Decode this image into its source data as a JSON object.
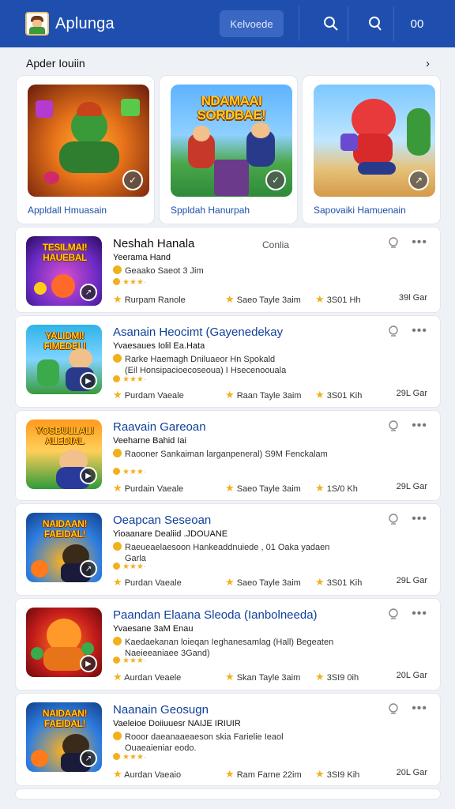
{
  "header": {
    "title": "Aplunga",
    "search_chip": "Kelvoede",
    "icons": [
      "search-icon",
      "search-alt-icon",
      "menu-icon"
    ],
    "right_text": "00"
  },
  "featured": {
    "heading": "Apder Iouiin",
    "cards": [
      {
        "label": "Appldall Hmuasain",
        "title": "",
        "colors": [
          "#e8741a",
          "#6a1c0c"
        ]
      },
      {
        "label": "Sppldah Hanurpah",
        "title": "NDAMAAI SORDBAE!",
        "colors": [
          "#5db3ff",
          "#2e8a3a"
        ]
      },
      {
        "label": "Sapovaiki Hamuenain",
        "title": "",
        "colors": [
          "#7cc8ff",
          "#e6c27a"
        ]
      }
    ]
  },
  "rows": [
    {
      "name": "Neshah Hanala",
      "name_dark": true,
      "contact": "Conlia",
      "subtitle": "Yeerama Hand",
      "desc1": "Geaako Saeot 3 Jim",
      "desc2": "",
      "rating_text": "★★★·",
      "foot": {
        "a": "Rurpam Ranole",
        "b": "Saeo Tayle 3aim",
        "c": "3S01 Hh",
        "d": "39l Gar"
      },
      "thumb_title": "TESILMAI! HAUEBAL",
      "colors": [
        "#6b2bc4",
        "#d94fd1"
      ]
    },
    {
      "name": "Asanain Heocimt (Gayenedekay",
      "name_dark": false,
      "contact": "",
      "subtitle": "Yvaesaues Iolil Ea.Hata",
      "desc1": "Rarke Haemagh Dniluaeor Hn Spokald",
      "desc2": "(Eil Honsipacioecoseoua)                  I Hsecenoouala",
      "rating_text": "★★★·",
      "foot": {
        "a": "Purdam Vaeale",
        "b": "Raan Tayle 3aim",
        "c": "3S01 Kih",
        "d": "29L Gar"
      },
      "thumb_title": "YALIDMI! FIMEDELI",
      "colors": [
        "#2fb3e8",
        "#3a9a3a"
      ]
    },
    {
      "name": "Raavain Gareoan",
      "name_dark": false,
      "contact": "",
      "subtitle": "Veeharne Bahid Iai",
      "desc1": "Raooner Sankaiman larganpeneral) S9M Fenckalam",
      "desc2": "",
      "rating_text": "★★★·",
      "foot": {
        "a": "Purdain Vaeale",
        "b": "Saeo Tayle 3aim",
        "c": "1S/0 Kh",
        "d": "29L Gar"
      },
      "thumb_title": "YOSBULLAL! ALEDIAL",
      "colors": [
        "#ff9a1e",
        "#2e9a3a"
      ]
    },
    {
      "name": "Oeapcan Seseoan",
      "name_dark": false,
      "contact": "",
      "subtitle": "Yioaanare Dealiid .JDOUANE",
      "desc1": "Raeueaelaesoon Hankeaddnuiede , 01 Oaka yadaen",
      "desc2": "Garla",
      "rating_text": "★★★·",
      "foot": {
        "a": "Purdan Vaeale",
        "b": "Saeo Tayle 3aim",
        "c": "3S01 Kih",
        "d": "29L Gar"
      },
      "thumb_title": "NAIDAAN! FAEIDAL!",
      "colors": [
        "#2e7de0",
        "#ffb11e"
      ]
    },
    {
      "name": "Paandan Elaana Sleoda (Ianbolneeda)",
      "name_dark": false,
      "contact": "",
      "subtitle": "Yvaesane 3aM Enau",
      "desc1": "Kaedaekanan loieqan Ieghanesamlag (Hall) Begeaten",
      "desc2": "Naeieeaniaee 3Gand)",
      "rating_text": "★★★·",
      "foot": {
        "a": "Aurdan Veaele",
        "b": "Skan Tayle 3aim",
        "c": "3SI9 0ih",
        "d": "20L Gar"
      },
      "thumb_title": "",
      "colors": [
        "#c51c1c",
        "#ff7a1a"
      ]
    },
    {
      "name": "Naanain Geosugn",
      "name_dark": false,
      "contact": "",
      "subtitle": "Vaeleioe Doiiuuesr NAIJE IRIUIR",
      "desc1": "Rooor daeanaaeaeson skia  Farielie Ieaol",
      "desc2": "Ouaeaieniar eodo.",
      "rating_text": "★★★·",
      "foot": {
        "a": "Aurdan Vaeaio",
        "b": "Ram Farne 22im",
        "c": "3SI9 Kih",
        "d": "20L Gar"
      },
      "thumb_title": "NAIDAAN! FAEIDAL!",
      "colors": [
        "#2e7de0",
        "#ffb11e"
      ]
    }
  ],
  "colors": {
    "header_bg": "#1f4fae",
    "accent": "#0f3f9a",
    "star": "#f2b01e"
  }
}
